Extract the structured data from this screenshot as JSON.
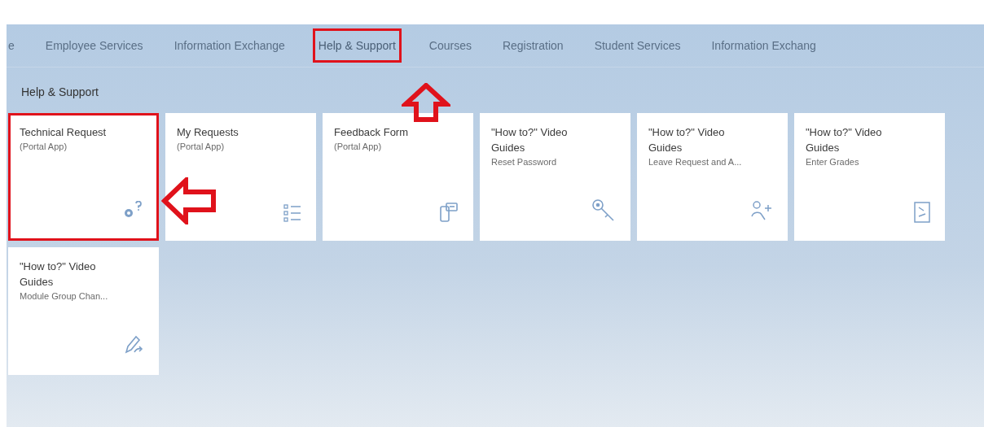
{
  "nav_tabs": [
    {
      "label": "e",
      "selected": false,
      "highlighted": false
    },
    {
      "label": "Employee Services",
      "selected": false,
      "highlighted": false
    },
    {
      "label": "Information Exchange",
      "selected": false,
      "highlighted": false
    },
    {
      "label": "Help & Support",
      "selected": true,
      "highlighted": true
    },
    {
      "label": "Courses",
      "selected": false,
      "highlighted": false
    },
    {
      "label": "Registration",
      "selected": false,
      "highlighted": false
    },
    {
      "label": "Student Services",
      "selected": false,
      "highlighted": false
    },
    {
      "label": "Information Exchang",
      "selected": false,
      "highlighted": false
    }
  ],
  "section_title": "Help & Support",
  "tiles": [
    {
      "title": "Technical Request",
      "subtitle": "(Portal App)",
      "highlighted": true
    },
    {
      "title": "My Requests",
      "subtitle": "(Portal App)",
      "highlighted": false
    },
    {
      "title": "Feedback Form",
      "subtitle": "(Portal App)",
      "highlighted": false
    },
    {
      "title": "\"How to?\" Video Guides",
      "subtitle": "Reset Password",
      "highlighted": false
    },
    {
      "title": "\"How to?\" Video Guides",
      "subtitle": "Leave Request and A...",
      "highlighted": false
    },
    {
      "title": "\"How to?\" Video Guides",
      "subtitle": "Enter Grades",
      "highlighted": false
    },
    {
      "title": "\"How to?\" Video Guides",
      "subtitle": "Module Group Chan...",
      "highlighted": false
    }
  ]
}
